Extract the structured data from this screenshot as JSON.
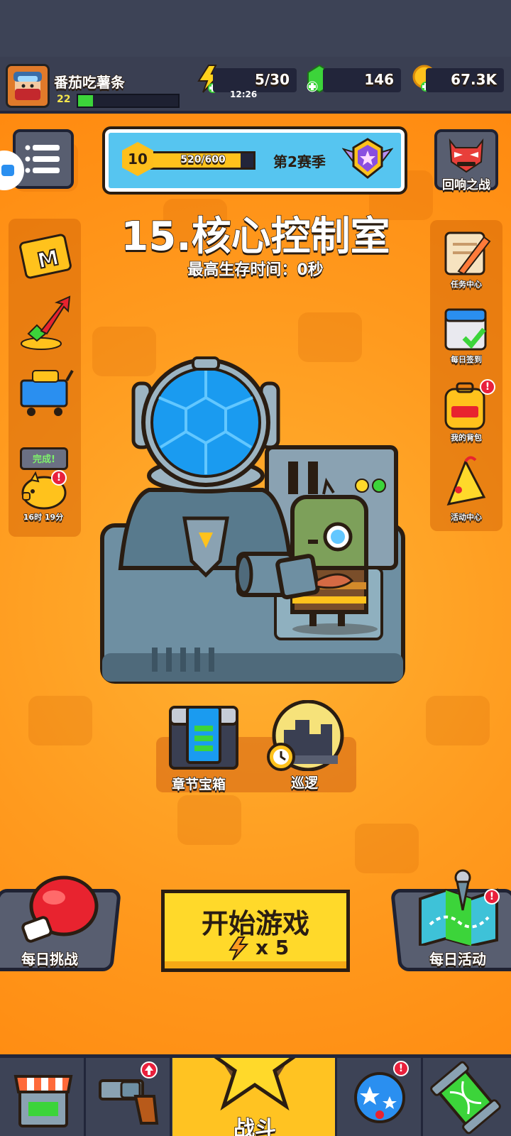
{
  "player": {
    "name": "番茄吃薯条",
    "level": "22"
  },
  "resources": {
    "energy": "5/30",
    "energy_timer": "12:26",
    "gems": "146",
    "coins": "67.3K"
  },
  "season": {
    "level": "10",
    "progress": "520/600",
    "progress_fraction": 0.87,
    "name": "第2赛季"
  },
  "top_right": {
    "echo_battle": "回响之战"
  },
  "left_menu": {
    "piggy_status": "完成!",
    "piggy_timer": "16时 19分"
  },
  "right_menu": {
    "tasks": "任务中心",
    "checkin": "每日签到",
    "backpack": "我的背包",
    "events": "活动中心"
  },
  "stage": {
    "title": "15.核心控制室",
    "best_time": "最高生存时间：0秒"
  },
  "rewards": {
    "chest": "章节宝箱",
    "patrol": "巡逻"
  },
  "actions": {
    "start": "开始游戏",
    "start_cost": "x 5",
    "daily_challenge": "每日挑战",
    "daily_event": "每日活动"
  },
  "nav": {
    "battle": "战斗"
  },
  "badge_text": "!",
  "colors": {
    "background": "#ff9a1e",
    "accent_yellow": "#ffd92a",
    "topbar": "#3a3f52",
    "badge": "#e9203c"
  }
}
